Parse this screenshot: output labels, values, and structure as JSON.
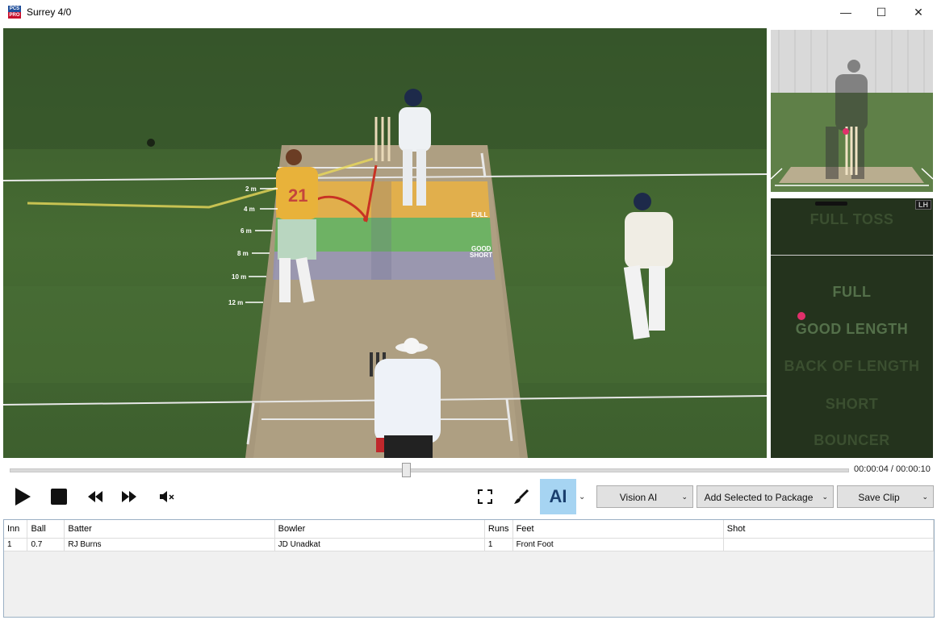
{
  "window": {
    "title": "Surrey 4/0",
    "logo_top": "PCS",
    "logo_bottom": "PRO",
    "minimize_icon": "—",
    "maximize_icon": "☐",
    "close_icon": "✕"
  },
  "video_overlay": {
    "distance_markers": [
      "2 m",
      "4 m",
      "6 m",
      "8 m",
      "10 m",
      "12 m"
    ],
    "zone_labels": [
      "FULL",
      "GOOD",
      "SHORT"
    ],
    "bowler_shirt_number": "21"
  },
  "pitch_map": {
    "badge": "LH",
    "zones": [
      "FULL TOSS",
      "FULL",
      "GOOD LENGTH",
      "BACK OF LENGTH",
      "SHORT",
      "BOUNCER"
    ],
    "marker_color": "#e0306b"
  },
  "playback": {
    "time": "00:00:04 / 00:00:10",
    "position_fraction": 0.4
  },
  "toolbar": {
    "ai_label": "AI",
    "vision_ai_label": "Vision AI",
    "add_package_label": "Add Selected to Package",
    "save_clip_label": "Save Clip"
  },
  "table": {
    "columns": [
      "Inn",
      "Ball",
      "Batter",
      "Bowler",
      "Runs",
      "Feet",
      "Shot"
    ],
    "rows": [
      [
        "1",
        "0.7",
        "RJ Burns",
        "JD Unadkat",
        "1",
        "Front Foot",
        ""
      ]
    ]
  },
  "colors": {
    "ai_button": "#a6d4f2",
    "zone_full": "#f2b43a",
    "zone_good": "#58b85a",
    "zone_short": "#8a8fd6",
    "ball_track": "#c83224"
  }
}
